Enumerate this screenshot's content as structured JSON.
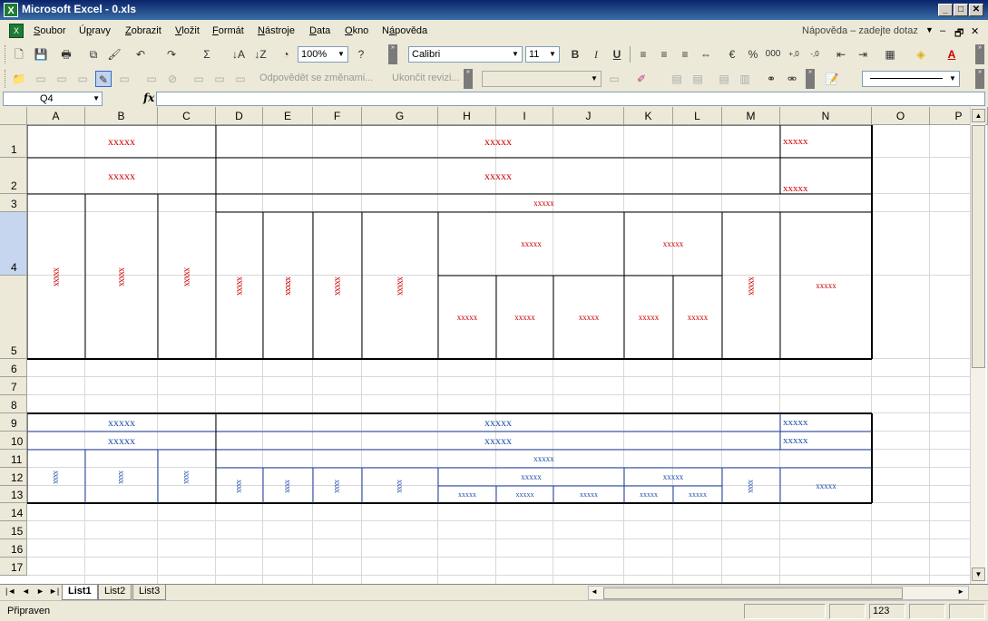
{
  "window": {
    "title": "Microsoft Excel - 0.xls",
    "app_icon": "X",
    "controls": [
      "_",
      "□",
      "✕"
    ]
  },
  "menu": {
    "items": [
      {
        "label": "Soubor",
        "key": "S"
      },
      {
        "label": "Úpravy",
        "key": "p"
      },
      {
        "label": "Zobrazit",
        "key": "Z"
      },
      {
        "label": "Vložit",
        "key": "V"
      },
      {
        "label": "Formát",
        "key": "F"
      },
      {
        "label": "Nástroje",
        "key": "N"
      },
      {
        "label": "Data",
        "key": "D"
      },
      {
        "label": "Okno",
        "key": "O"
      },
      {
        "label": "Nápověda",
        "key": "á"
      }
    ],
    "help_placeholder": "Nápověda – zadejte dotaz",
    "doc_controls": [
      "–",
      "🗗",
      "✕"
    ]
  },
  "toolbar1": {
    "zoom": "100%",
    "font_name": "Calibri",
    "font_size": "11",
    "bold": "B",
    "italic": "I",
    "underline": "U",
    "percent": "%",
    "thousands": "000",
    "sum": "Σ",
    "dec_inc": ",0 ,00",
    "dec_dec": ",00 ,0"
  },
  "toolbar2": {
    "reply_changes": "Odpovědět se změnami...",
    "end_review": "Ukončit revizi..."
  },
  "formula_bar": {
    "name_box": "Q4",
    "fx": "fx",
    "formula": ""
  },
  "sheet": {
    "columns": [
      "A",
      "B",
      "C",
      "D",
      "E",
      "F",
      "G",
      "H",
      "I",
      "J",
      "K",
      "L",
      "M",
      "N",
      "O",
      "P"
    ],
    "rows": [
      "1",
      "2",
      "3",
      "4",
      "5",
      "6",
      "7",
      "8",
      "9",
      "10",
      "11",
      "12",
      "13",
      "14",
      "15",
      "16",
      "17"
    ],
    "selected_row": "4",
    "cells": {
      "placeholder": "xxxxx",
      "placeholder_short": "xxxx"
    }
  },
  "tabs": {
    "sheets": [
      "List1",
      "List2",
      "List3"
    ],
    "active": "List1",
    "nav": [
      "|◄",
      "◄",
      "►",
      "►|"
    ]
  },
  "status": {
    "text": "Připraven",
    "indicator": "123"
  },
  "colors": {
    "red_text": "#cc0000",
    "blue_text": "#1f4ea8",
    "title_gradient_start": "#0a246a",
    "chrome": "#ece9d8"
  }
}
